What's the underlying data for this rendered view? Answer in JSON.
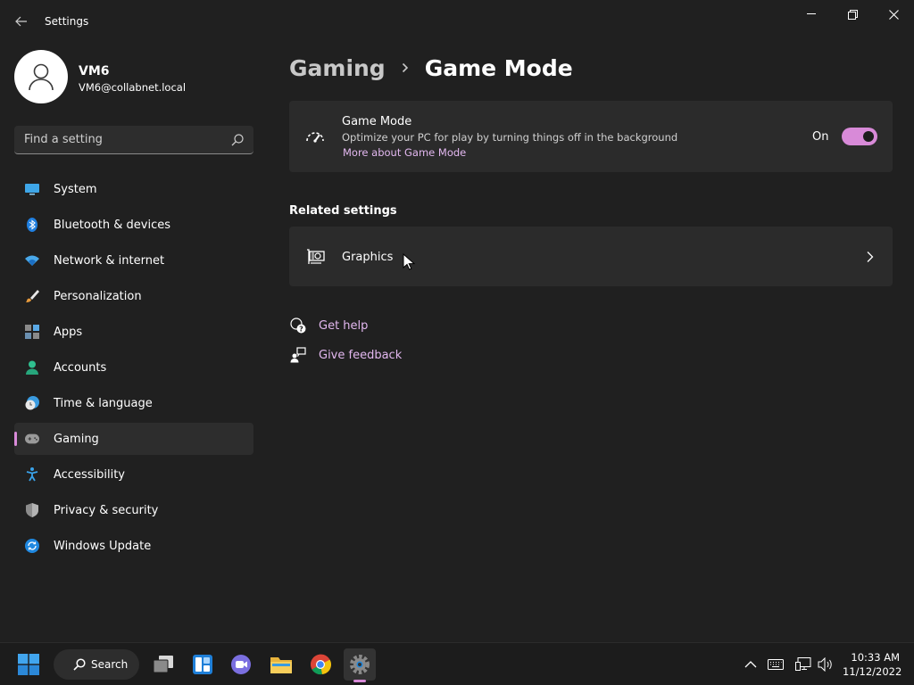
{
  "window": {
    "title": "Settings"
  },
  "profile": {
    "name": "VM6",
    "email": "VM6@collabnet.local"
  },
  "search": {
    "placeholder": "Find a setting"
  },
  "nav": {
    "items": [
      {
        "label": "System",
        "icon": "monitor-icon"
      },
      {
        "label": "Bluetooth & devices",
        "icon": "bluetooth-icon"
      },
      {
        "label": "Network & internet",
        "icon": "wifi-icon"
      },
      {
        "label": "Personalization",
        "icon": "brush-icon"
      },
      {
        "label": "Apps",
        "icon": "apps-icon"
      },
      {
        "label": "Accounts",
        "icon": "person-icon"
      },
      {
        "label": "Time & language",
        "icon": "clock-globe-icon"
      },
      {
        "label": "Gaming",
        "icon": "gamepad-icon",
        "selected": true
      },
      {
        "label": "Accessibility",
        "icon": "accessibility-icon"
      },
      {
        "label": "Privacy & security",
        "icon": "shield-icon"
      },
      {
        "label": "Windows Update",
        "icon": "update-icon"
      }
    ]
  },
  "breadcrumb": {
    "parent": "Gaming",
    "current": "Game Mode"
  },
  "game_mode": {
    "title": "Game Mode",
    "description": "Optimize your PC for play by turning things off in the background",
    "link": "More about Game Mode",
    "state_label": "On",
    "enabled": true
  },
  "related": {
    "heading": "Related settings",
    "graphics_label": "Graphics"
  },
  "help": {
    "get_help": "Get help",
    "give_feedback": "Give feedback"
  },
  "taskbar": {
    "search_label": "Search",
    "time": "10:33 AM",
    "date": "11/12/2022"
  },
  "colors": {
    "accent": "#d88ad8",
    "link": "#e3b8f0",
    "background": "#202020",
    "card": "#2b2b2b"
  }
}
